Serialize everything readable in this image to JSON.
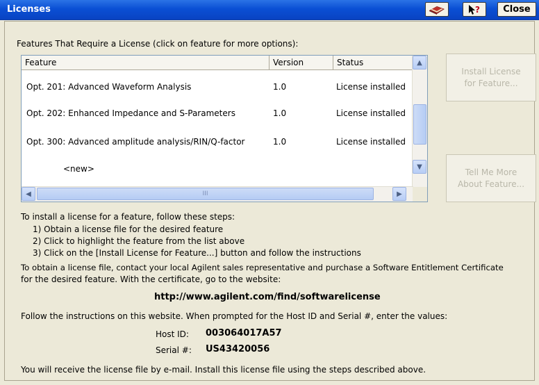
{
  "window": {
    "title": "Licenses",
    "close_label": "Close"
  },
  "features": {
    "section_label": "Features That Require a License (click on feature for more options):",
    "columns": [
      "Feature",
      "Version",
      "Status"
    ],
    "rows": [
      {
        "feature": "Opt. 201: Advanced Waveform Analysis",
        "version": "1.0",
        "status": "License installed"
      },
      {
        "feature": "Opt. 202: Enhanced Impedance and S-Parameters",
        "version": "1.0",
        "status": "License installed"
      },
      {
        "feature": "Opt. 300: Advanced amplitude analysis/RIN/Q-factor",
        "version": "1.0",
        "status": "License installed"
      },
      {
        "feature": "<new>",
        "version": "",
        "status": ""
      }
    ],
    "thumb_grip": "III"
  },
  "buttons": {
    "install_line1": "Install License",
    "install_line2": "for Feature...",
    "tellme_line1": "Tell Me More",
    "tellme_line2": "About Feature..."
  },
  "instructions": {
    "intro": "To install a license for a feature, follow these steps:",
    "steps": [
      "1) Obtain a license file for the desired feature",
      "2) Click to highlight the feature from the list above",
      "3) Click on the [Install License for Feature...] button and follow the instructions"
    ],
    "obtain_line1": "To obtain a license file, contact your local Agilent sales representative and purchase a Software Entitlement Certificate",
    "obtain_line2": "for the desired feature.  With the certificate, go to the website:",
    "url": "http://www.agilent.com/find/softwarelicense",
    "follow": "Follow the instructions on this website.  When prompted for the Host ID and Serial #, enter the values:",
    "host_label": "Host ID:",
    "host_value": "003064017A57",
    "serial_label": "Serial #:",
    "serial_value": "US43420056",
    "final": "You will receive the license file by e-mail.  Install this license file using the steps described above."
  }
}
